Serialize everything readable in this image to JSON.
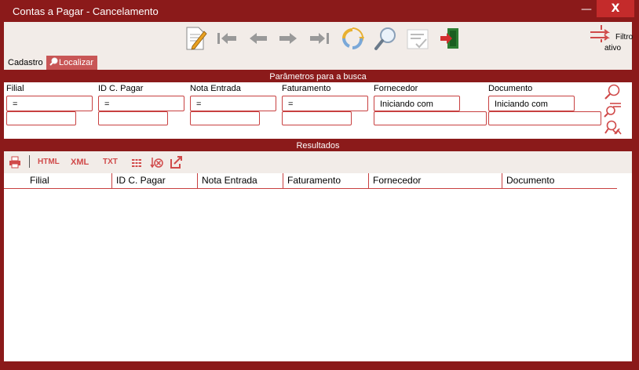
{
  "window": {
    "title": "Contas a Pagar - Cancelamento",
    "minimize_label": "—",
    "close_label": "X"
  },
  "toolbar": {
    "icons": [
      "edit-document-icon",
      "first-record-icon",
      "previous-record-icon",
      "next-record-icon",
      "last-record-icon",
      "refresh-icon",
      "search-icon",
      "checklist-icon",
      "exit-icon"
    ],
    "filtro_line1": "Filtro",
    "filtro_line2": "ativo"
  },
  "tabs": {
    "cadastro": "Cadastro",
    "localizar": "Localizar"
  },
  "params_header": "Parâmetros para a busca",
  "params": [
    {
      "label": "Filial",
      "operator": "=",
      "value": ""
    },
    {
      "label": "ID C. Pagar",
      "operator": "=",
      "value": ""
    },
    {
      "label": "Nota Entrada",
      "operator": "=",
      "value": ""
    },
    {
      "label": "Faturamento",
      "operator": "=",
      "value": ""
    },
    {
      "label": "Fornecedor",
      "operator": "Iniciando com",
      "value": ""
    },
    {
      "label": "Documento",
      "operator": "Iniciando com",
      "value": ""
    }
  ],
  "results_header": "Resultados",
  "results_toolbar": {
    "html": "HTML",
    "xml": "XML",
    "txt": "TXT"
  },
  "grid": {
    "columns": [
      "Filial",
      "ID C. Pagar",
      "Nota Entrada",
      "Faturamento",
      "Fornecedor",
      "Documento"
    ]
  },
  "colors": {
    "frame": "#8b1a1a",
    "accent": "#c84040",
    "panel": "#f2ece8"
  }
}
